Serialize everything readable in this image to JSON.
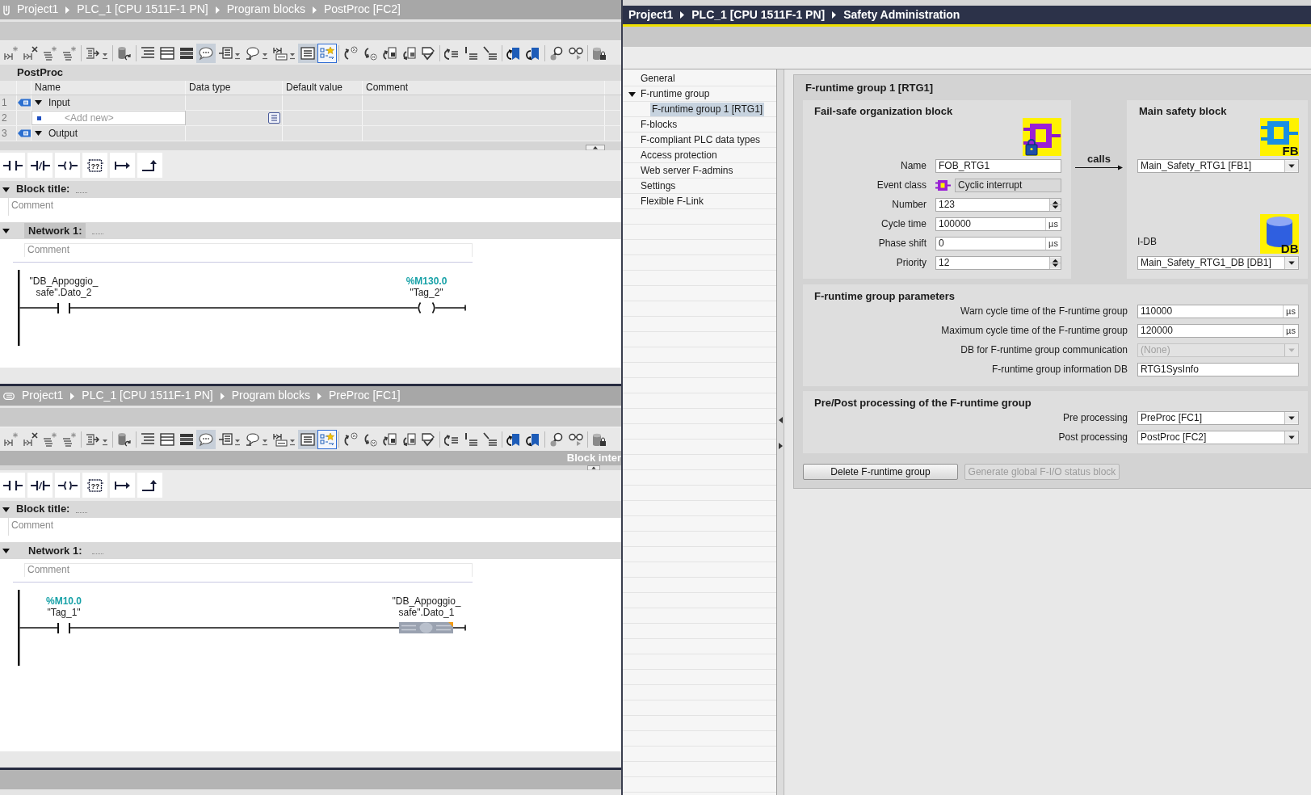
{
  "editors": [
    {
      "pinned": true,
      "breadcrumb": [
        "Project1",
        "PLC_1 [CPU 1511F-1 PN]",
        "Program blocks",
        "PostProc [FC2]"
      ],
      "toolbar_toggles": [
        {
          "on": true
        },
        {
          "on": true
        },
        {
          "on": true
        }
      ],
      "interface": {
        "title": "PostProc",
        "columns": [
          "Name",
          "Data type",
          "Default value",
          "Comment"
        ],
        "rows": [
          {
            "number": "1",
            "kind": "section",
            "name": "Input",
            "expanded": true
          },
          {
            "number": "2",
            "kind": "add",
            "placeholder": "<Add new>"
          },
          {
            "number": "3",
            "kind": "section",
            "name": "Output",
            "expanded": true
          }
        ]
      },
      "instruction_box_caption": "??",
      "block_title": {
        "label": "Block title:",
        "expanded": true,
        "comment_placeholder": "Comment"
      },
      "networks": [
        {
          "label": "Network 1:",
          "expanded": true,
          "selected": true,
          "comment_placeholder": "Comment",
          "contact": {
            "operand_lines": [
              "\"DB_Appoggio_",
              "safe\".Dato_2"
            ]
          },
          "coil": {
            "kind": "plain",
            "address": "%M130.0",
            "operand_lines": [
              "\"Tag_2\""
            ]
          }
        }
      ]
    },
    {
      "pinned": false,
      "breadcrumb": [
        "Project1",
        "PLC_1 [CPU 1511F-1 PN]",
        "Program blocks",
        "PreProc [FC1]"
      ],
      "toolbar_toggles": [
        {
          "on": true
        },
        {
          "on": true
        },
        {
          "on": true
        }
      ],
      "interface_label": "Block inter",
      "instruction_box_caption": "??",
      "block_title": {
        "label": "Block title:",
        "expanded": true,
        "comment_placeholder": "Comment"
      },
      "networks": [
        {
          "label": "Network 1:",
          "expanded": true,
          "selected": false,
          "comment_placeholder": "Comment",
          "contact": {
            "address": "%M10.0",
            "operand_lines": [
              "\"Tag_1\""
            ]
          },
          "coil": {
            "kind": "boxed",
            "operand_lines": [
              "\"DB_Appoggio_",
              "safe\".Dato_1"
            ]
          }
        }
      ]
    }
  ],
  "safety_administration": {
    "breadcrumb": [
      "Project1",
      "PLC_1 [CPU 1511F-1 PN]",
      "Safety Administration"
    ],
    "navigation": [
      {
        "label": "General",
        "selected": false
      },
      {
        "label": "F-runtime group",
        "selected": false,
        "expanded": true,
        "children": [
          {
            "label": "F-runtime group 1 [RTG1]",
            "selected": true
          }
        ]
      },
      {
        "label": "F-blocks",
        "selected": false
      },
      {
        "label": "F-compliant PLC data types",
        "selected": false
      },
      {
        "label": "Access protection",
        "selected": false
      },
      {
        "label": "Web server F-admins",
        "selected": false
      },
      {
        "label": "Settings",
        "selected": false
      },
      {
        "label": "Flexible F-Link",
        "selected": false
      }
    ],
    "group": {
      "title": "F-runtime group 1 [RTG1]",
      "fob": {
        "title": "Fail-safe organization block",
        "fields": [
          {
            "kind": "text",
            "label": "Name",
            "value": "FOB_RTG1"
          },
          {
            "kind": "readonly",
            "label": "Event class",
            "value": "Cyclic interrupt"
          },
          {
            "kind": "spin",
            "label": "Number",
            "value": "123"
          },
          {
            "kind": "unit",
            "label": "Cycle time",
            "value": "100000",
            "unit": "µs"
          },
          {
            "kind": "unit",
            "label": "Phase shift",
            "value": "0",
            "unit": "µs"
          },
          {
            "kind": "spin",
            "label": "Priority",
            "value": "12"
          }
        ]
      },
      "calls_label": "calls",
      "main_block": {
        "title": "Main safety block",
        "block_icon_caption": "FB",
        "block": {
          "kind": "dropdown",
          "value": "Main_Safety_RTG1 [FB1]",
          "disabled": false
        },
        "idb_label": "I-DB",
        "idb_icon_caption": "DB",
        "idb": {
          "kind": "dropdown",
          "value": "Main_Safety_RTG1_DB [DB1]",
          "disabled": false
        }
      },
      "parameters": {
        "title": "F-runtime group parameters",
        "fields": [
          {
            "kind": "unit",
            "label": "Warn cycle time of the F-runtime group",
            "value": "110000",
            "unit": "µs",
            "disabled": false
          },
          {
            "kind": "unit",
            "label": "Maximum cycle time of the F-runtime group",
            "value": "120000",
            "unit": "µs",
            "disabled": false
          },
          {
            "kind": "dropdown",
            "label": "DB for F-runtime group communication",
            "value": "(None)",
            "disabled": true
          },
          {
            "kind": "text",
            "label": "F-runtime group information DB",
            "value": "RTG1SysInfo",
            "disabled": false
          }
        ]
      },
      "processing": {
        "title": "Pre/Post processing of the F-runtime group",
        "fields": [
          {
            "kind": "dropdown",
            "label": "Pre processing",
            "value": "PreProc [FC1]",
            "disabled": false
          },
          {
            "kind": "dropdown",
            "label": "Post processing",
            "value": "PostProc [FC2]",
            "disabled": false
          }
        ]
      },
      "buttons": [
        {
          "label": "Delete F-runtime group",
          "disabled": false
        },
        {
          "label": "Generate global F-I/O status block",
          "disabled": true
        }
      ]
    }
  }
}
